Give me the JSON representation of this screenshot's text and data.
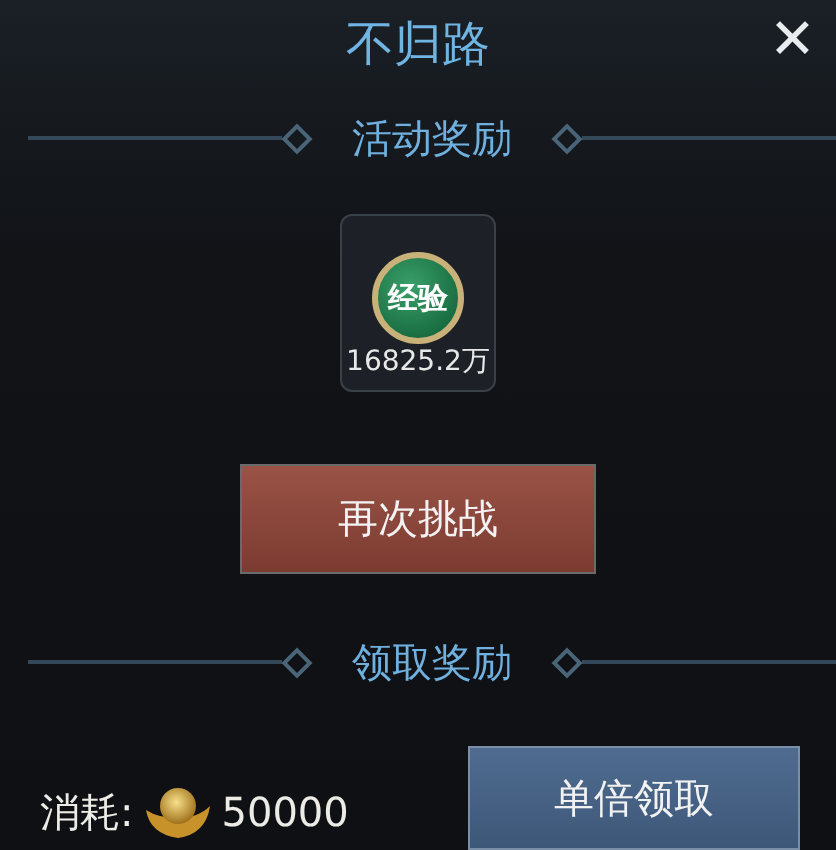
{
  "window": {
    "title": "不归路",
    "close": "✕"
  },
  "activity_reward": {
    "heading": "活动奖励",
    "item": {
      "badge": "经验",
      "amount": "16825.2万"
    },
    "button": "再次挑战"
  },
  "claim_reward": {
    "heading": "领取奖励",
    "cost_label": "消耗:",
    "cost": "50000",
    "button": "单倍领取"
  }
}
